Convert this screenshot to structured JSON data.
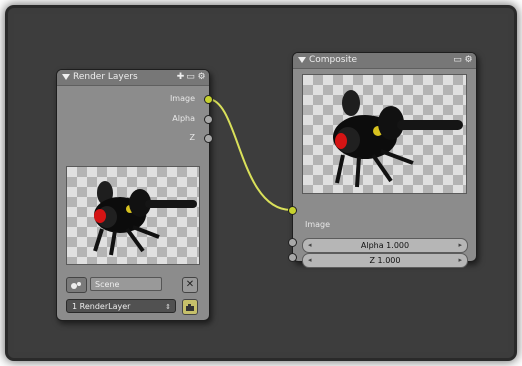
{
  "render_layers_node": {
    "title": "Render Layers",
    "outputs": {
      "image": "Image",
      "alpha": "Alpha",
      "z": "Z"
    },
    "scene_field": "Scene",
    "layer_dropdown": "1 RenderLayer"
  },
  "composite_node": {
    "title": "Composite",
    "input_image": "Image",
    "alpha_field": "Alpha 1.000",
    "z_field": "Z 1.000"
  },
  "link_color": "#d9e05a",
  "icons": {
    "collapse": "triangle-down-icon",
    "node_plus": "plus-icon",
    "node_hide": "hide-icon",
    "node_gear": "gear-icon",
    "scene_browse": "scene-browse-icon",
    "scene_clear": "x-icon",
    "render_button": "camera-icon"
  }
}
